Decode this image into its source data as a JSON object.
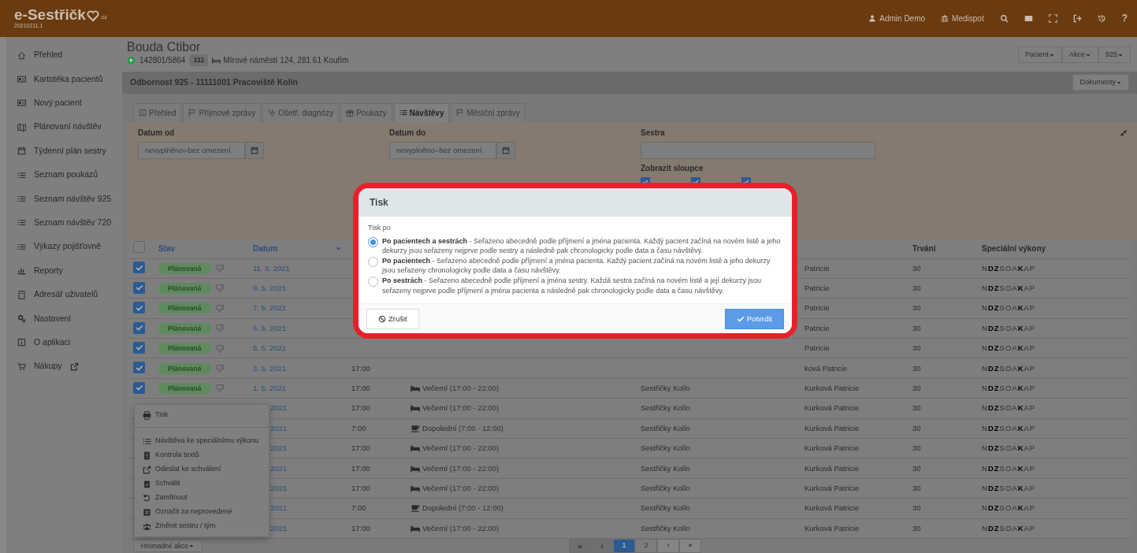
{
  "topbar": {
    "logo": "e-Sestřičk",
    "logo_suffix": ".cz",
    "version": "20210211.1",
    "actions": [
      {
        "kind": "user",
        "label": "Admin Demo"
      },
      {
        "kind": "bank",
        "label": "Medispot"
      },
      {
        "kind": "search"
      },
      {
        "kind": "mail"
      },
      {
        "kind": "expand"
      },
      {
        "kind": "logout"
      },
      {
        "kind": "history"
      },
      {
        "kind": "text",
        "label": "?"
      }
    ]
  },
  "sidebar": {
    "items": [
      {
        "kind": "house",
        "label": "Přehled"
      },
      {
        "kind": "idcard",
        "label": "Kartotéka pacientů"
      },
      {
        "kind": "idcard",
        "label": "Nový pacient"
      },
      {
        "kind": "map",
        "label": "Plánovaní návštěv"
      },
      {
        "kind": "calendar",
        "label": "Týdenní plán sestry"
      },
      {
        "kind": "list",
        "label": "Seznam poukazů"
      },
      {
        "kind": "list",
        "label": "Seznam návštěv 925"
      },
      {
        "kind": "list",
        "label": "Seznam návštěv 720"
      },
      {
        "kind": "list",
        "label": "Výkazy pojišťovně"
      },
      {
        "kind": "chart",
        "label": "Reporty"
      },
      {
        "kind": "book",
        "label": "Adresář uživatelů"
      },
      {
        "kind": "gears",
        "label": "Nastavení"
      },
      {
        "kind": "info",
        "label": "O aplikaci"
      },
      {
        "kind": "cart",
        "label": "Nákupy",
        "external": true
      }
    ]
  },
  "patient": {
    "name": "Bouda Ctibor",
    "id": "142801/5864",
    "code": "111",
    "address": "Mírové náměstí 124, 281 61 Kouřim",
    "menus": [
      "Pacient",
      "Akce",
      "925"
    ]
  },
  "department": {
    "title": "Odbornost 925 - 11111001 Pracoviště Kolín",
    "documents": "Dokumenty"
  },
  "tabs": [
    {
      "kind": "infobox",
      "label": "Přehled",
      "selected": false
    },
    {
      "kind": "flag",
      "label": "Příjmové zprávy",
      "selected": false
    },
    {
      "kind": "stethoscope",
      "label": "Ošetř. diagnózy",
      "selected": false
    },
    {
      "kind": "gift",
      "label": "Poukazy",
      "selected": false
    },
    {
      "kind": "list",
      "label": "Návštěvy",
      "selected": true
    },
    {
      "kind": "flag",
      "label": "Měsíční zprávy",
      "selected": false
    }
  ],
  "filters": {
    "fields": [
      {
        "kind": "date",
        "label": "Datum od",
        "placeholder": "nevyplněno=bez omezení"
      },
      {
        "kind": "date",
        "label": "Datum do",
        "placeholder": "nevyplněno=bez omezení"
      },
      {
        "kind": "text",
        "label": "Sestra"
      }
    ],
    "columns_label": "Zobrazit sloupce",
    "column_toggles": [
      {
        "checked": true
      },
      {
        "checked": true
      },
      {
        "checked": true
      }
    ]
  },
  "table": {
    "select_all": {
      "checked": false
    },
    "headers": {
      "status": "Stav",
      "date": "Datum",
      "duration": "Trvání",
      "special": "Speciální výkony"
    },
    "rows": [
      {
        "checked": true,
        "status": "Plánovaná",
        "date": "11. 5. 2021",
        "nurse": "Patricie",
        "duration": "30",
        "special": [
          {
            "t": "N",
            "on": false
          },
          {
            "t": "D",
            "on": true
          },
          {
            "t": "Z",
            "on": true
          },
          {
            "t": "S",
            "on": false
          },
          {
            "t": "O",
            "on": false
          },
          {
            "t": "A",
            "on": false
          },
          {
            "t": "K",
            "on": true
          },
          {
            "t": "A",
            "on": false
          },
          {
            "t": "P",
            "on": false
          }
        ]
      },
      {
        "checked": true,
        "status": "Plánovaná",
        "date": "9. 5. 2021",
        "nurse": "Patricie",
        "duration": "30",
        "special": [
          {
            "t": "N",
            "on": false
          },
          {
            "t": "D",
            "on": true
          },
          {
            "t": "Z",
            "on": true
          },
          {
            "t": "S",
            "on": false
          },
          {
            "t": "O",
            "on": false
          },
          {
            "t": "A",
            "on": false
          },
          {
            "t": "K",
            "on": true
          },
          {
            "t": "A",
            "on": false
          },
          {
            "t": "P",
            "on": false
          }
        ]
      },
      {
        "checked": true,
        "status": "Plánovaná",
        "date": "7. 5. 2021",
        "nurse": "Patricie",
        "duration": "30",
        "special": [
          {
            "t": "N",
            "on": false
          },
          {
            "t": "D",
            "on": true
          },
          {
            "t": "Z",
            "on": true
          },
          {
            "t": "S",
            "on": false
          },
          {
            "t": "O",
            "on": false
          },
          {
            "t": "A",
            "on": false
          },
          {
            "t": "K",
            "on": true
          },
          {
            "t": "A",
            "on": false
          },
          {
            "t": "P",
            "on": false
          }
        ]
      },
      {
        "checked": true,
        "status": "Plánovaná",
        "date": "6. 5. 2021",
        "nurse": "Patricie",
        "duration": "30",
        "special": [
          {
            "t": "N",
            "on": false
          },
          {
            "t": "D",
            "on": true
          },
          {
            "t": "Z",
            "on": true
          },
          {
            "t": "S",
            "on": false
          },
          {
            "t": "O",
            "on": false
          },
          {
            "t": "A",
            "on": false
          },
          {
            "t": "K",
            "on": true
          },
          {
            "t": "A",
            "on": false
          },
          {
            "t": "P",
            "on": false
          }
        ]
      },
      {
        "checked": true,
        "status": "Plánovaná",
        "date": "5. 5. 2021",
        "nurse": "Patricie",
        "duration": "30",
        "special": [
          {
            "t": "N",
            "on": false
          },
          {
            "t": "D",
            "on": true
          },
          {
            "t": "Z",
            "on": true
          },
          {
            "t": "S",
            "on": false
          },
          {
            "t": "O",
            "on": false
          },
          {
            "t": "A",
            "on": false
          },
          {
            "t": "K",
            "on": true
          },
          {
            "t": "A",
            "on": false
          },
          {
            "t": "P",
            "on": false
          }
        ]
      },
      {
        "checked": true,
        "status": "Plánovaná",
        "date": "3. 5. 2021",
        "time": "17:00",
        "nurse": "ková Patricie",
        "duration": "30",
        "special": [
          {
            "t": "N",
            "on": false
          },
          {
            "t": "D",
            "on": true
          },
          {
            "t": "Z",
            "on": true
          },
          {
            "t": "S",
            "on": false
          },
          {
            "t": "O",
            "on": false
          },
          {
            "t": "A",
            "on": false
          },
          {
            "t": "K",
            "on": true
          },
          {
            "t": "A",
            "on": false
          },
          {
            "t": "P",
            "on": false
          }
        ]
      },
      {
        "checked": true,
        "status": "Plánovaná",
        "date": "1. 5. 2021",
        "time": "17:00",
        "shift": {
          "kind": "evening",
          "name": "Večerní",
          "hours": "(17:00 - 22:00)"
        },
        "team": "Sestřičky Kolín",
        "nurse": "Kurková Patricie",
        "duration": "30",
        "special": [
          {
            "t": "N",
            "on": false
          },
          {
            "t": "D",
            "on": true
          },
          {
            "t": "Z",
            "on": true
          },
          {
            "t": "S",
            "on": false
          },
          {
            "t": "O",
            "on": false
          },
          {
            "t": "A",
            "on": false
          },
          {
            "t": "K",
            "on": true
          },
          {
            "t": "A",
            "on": false
          },
          {
            "t": "P",
            "on": false
          }
        ]
      },
      {
        "date": "2021",
        "time": "17:00",
        "shift": {
          "kind": "evening",
          "name": "Večerní",
          "hours": "(17:00 - 22:00)"
        },
        "team": "Sestřičky Kolín",
        "nurse": "Kurková Patricie",
        "duration": "30",
        "special": [
          {
            "t": "N",
            "on": false
          },
          {
            "t": "D",
            "on": true
          },
          {
            "t": "Z",
            "on": true
          },
          {
            "t": "S",
            "on": false
          },
          {
            "t": "O",
            "on": false
          },
          {
            "t": "A",
            "on": false
          },
          {
            "t": "K",
            "on": true
          },
          {
            "t": "A",
            "on": false
          },
          {
            "t": "P",
            "on": false
          }
        ]
      },
      {
        "date": "2021",
        "time": "7:00",
        "shift": {
          "kind": "morning",
          "name": "Dopolední",
          "hours": "(7:00 - 12:00)"
        },
        "team": "Sestřičky Kolín",
        "nurse": "Kurková Patricie",
        "duration": "30",
        "special": [
          {
            "t": "N",
            "on": false
          },
          {
            "t": "D",
            "on": true
          },
          {
            "t": "Z",
            "on": true
          },
          {
            "t": "S",
            "on": false
          },
          {
            "t": "O",
            "on": false
          },
          {
            "t": "A",
            "on": false
          },
          {
            "t": "K",
            "on": true
          },
          {
            "t": "A",
            "on": false
          },
          {
            "t": "P",
            "on": false
          }
        ]
      },
      {
        "date": "2021",
        "time": "17:00",
        "shift": {
          "kind": "evening",
          "name": "Večerní",
          "hours": "(17:00 - 22:00)"
        },
        "team": "Sestřičky Kolín",
        "nurse": "Kurková Patricie",
        "duration": "30",
        "special": [
          {
            "t": "N",
            "on": false
          },
          {
            "t": "D",
            "on": true
          },
          {
            "t": "Z",
            "on": true
          },
          {
            "t": "S",
            "on": false
          },
          {
            "t": "O",
            "on": false
          },
          {
            "t": "A",
            "on": false
          },
          {
            "t": "K",
            "on": true
          },
          {
            "t": "A",
            "on": false
          },
          {
            "t": "P",
            "on": false
          }
        ]
      },
      {
        "date": "2021",
        "time": "17:00",
        "shift": {
          "kind": "evening",
          "name": "Večerní",
          "hours": "(17:00 - 22:00)"
        },
        "team": "Sestřičky Kolín",
        "nurse": "Kurková Patricie",
        "duration": "30",
        "special": [
          {
            "t": "N",
            "on": false
          },
          {
            "t": "D",
            "on": true
          },
          {
            "t": "Z",
            "on": true
          },
          {
            "t": "S",
            "on": false
          },
          {
            "t": "O",
            "on": false
          },
          {
            "t": "A",
            "on": false
          },
          {
            "t": "K",
            "on": true
          },
          {
            "t": "A",
            "on": false
          },
          {
            "t": "P",
            "on": false
          }
        ]
      },
      {
        "date": "2021",
        "time": "17:00",
        "shift": {
          "kind": "evening",
          "name": "Večerní",
          "hours": "(17:00 - 22:00)"
        },
        "team": "Sestřičky Kolín",
        "nurse": "Kurková Patricie",
        "duration": "30",
        "special": [
          {
            "t": "N",
            "on": false
          },
          {
            "t": "D",
            "on": true
          },
          {
            "t": "Z",
            "on": true
          },
          {
            "t": "S",
            "on": false
          },
          {
            "t": "O",
            "on": false
          },
          {
            "t": "A",
            "on": false
          },
          {
            "t": "K",
            "on": true
          },
          {
            "t": "A",
            "on": false
          },
          {
            "t": "P",
            "on": false
          }
        ]
      },
      {
        "date": "2021",
        "time": "7:00",
        "shift": {
          "kind": "morning",
          "name": "Dopolední",
          "hours": "(7:00 - 12:00)"
        },
        "team": "Sestřičky Kolín",
        "nurse": "Kurková Patricie",
        "duration": "30",
        "special": [
          {
            "t": "N",
            "on": false
          },
          {
            "t": "D",
            "on": true
          },
          {
            "t": "Z",
            "on": true
          },
          {
            "t": "S",
            "on": false
          },
          {
            "t": "O",
            "on": false
          },
          {
            "t": "A",
            "on": false
          },
          {
            "t": "K",
            "on": true
          },
          {
            "t": "A",
            "on": false
          },
          {
            "t": "P",
            "on": false
          }
        ]
      },
      {
        "date": "2021",
        "time": "17:00",
        "shift": {
          "kind": "evening",
          "name": "Večerní",
          "hours": "(17:00 - 22:00)"
        },
        "team": "Sestřičky Kolín",
        "nurse": "Kurková Patricie",
        "duration": "30",
        "special": [
          {
            "t": "N",
            "on": false
          },
          {
            "t": "D",
            "on": true
          },
          {
            "t": "Z",
            "on": true
          },
          {
            "t": "S",
            "on": false
          },
          {
            "t": "O",
            "on": false
          },
          {
            "t": "A",
            "on": false
          },
          {
            "t": "K",
            "on": true
          },
          {
            "t": "A",
            "on": false
          },
          {
            "t": "P",
            "on": false
          }
        ]
      }
    ]
  },
  "bulk_menu": {
    "items": [
      {
        "kind": "printer",
        "label": "Tisk"
      },
      {
        "kind": "divider"
      },
      {
        "kind": "list",
        "label": "Návštěva ke speciálnímu výkonu"
      },
      {
        "kind": "doc",
        "label": "Kontrola textů"
      },
      {
        "kind": "share",
        "label": "Odeslat ke schválení"
      },
      {
        "kind": "clipboard",
        "label": "Schválit"
      },
      {
        "kind": "undo",
        "label": "Zamítnout"
      },
      {
        "kind": "xsquare",
        "label": "Označit za neprovedené"
      },
      {
        "kind": "users",
        "label": "Změnit sestru / tým"
      }
    ],
    "button": "Hromadné akce"
  },
  "pagination": [
    {
      "label": "«",
      "disabled": true
    },
    {
      "label": "‹",
      "disabled": true
    },
    {
      "label": "1",
      "selected": true
    },
    {
      "label": "2",
      "selected": false
    },
    {
      "label": "›",
      "disabled": false
    },
    {
      "label": "»",
      "disabled": false
    }
  ],
  "modal": {
    "title": "Tisk",
    "group_label": "Tisk po",
    "options": [
      {
        "text": "**Po pacientech a sestrách** - Seřazeno abecedně podle příjmení a jména pacienta. Každý pacient začíná na novém listě a jeho dekurzy jsou seřazeny nejprve podle sestry a následně pak chronologicky podle data a času návštěvy.",
        "selected": true
      },
      {
        "text": "**Po pacientech** - Seřazeno abecedně podle příjmení a jména pacienta. Každý pacient začíná na novém listě a jeho dekurzy jsou seřazeny chronologicky podle data a času návštěvy.",
        "selected": false
      },
      {
        "text": "**Po sestrách** - Seřazeno abecedně podle příjmení a jména sestry. Každá sestra začíná na novém listě a její dekurzy jsou seřazeny nejprve podle příjmení a jména pacienta a následně pak chronologicky podle data a času návštěvy.",
        "selected": false
      }
    ],
    "cancel": "Zrušit",
    "confirm": "Potvrdit"
  }
}
